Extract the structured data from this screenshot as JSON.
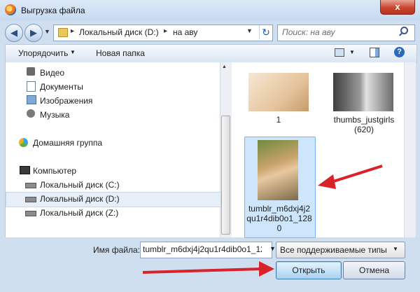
{
  "window": {
    "title": "Выгрузка файла",
    "close_label": "x"
  },
  "address": {
    "crumbs": [
      "Локальный диск (D:)",
      "на аву"
    ],
    "separator": "▸"
  },
  "search": {
    "placeholder": "Поиск: на аву"
  },
  "toolbar": {
    "organize_label": "Упорядочить",
    "new_folder_label": "Новая папка",
    "help_label": "?"
  },
  "nav": {
    "items": [
      {
        "label": "Видео",
        "icon": "video-library-icon"
      },
      {
        "label": "Документы",
        "icon": "documents-library-icon"
      },
      {
        "label": "Изображения",
        "icon": "pictures-library-icon"
      },
      {
        "label": "Музыка",
        "icon": "music-library-icon"
      },
      {
        "label": "Домашняя группа",
        "icon": "homegroup-icon"
      },
      {
        "label": "Компьютер",
        "icon": "computer-icon"
      },
      {
        "label": "Локальный диск (C:)",
        "icon": "disk-icon"
      },
      {
        "label": "Локальный диск (D:)",
        "icon": "disk-icon"
      },
      {
        "label": "Локальный диск (Z:)",
        "icon": "disk-icon"
      }
    ]
  },
  "files": [
    {
      "caption": "1"
    },
    {
      "caption": "thumbs_justgirls",
      "caption2": "(620)"
    },
    {
      "caption": "tumblr_m6dxj4j2",
      "caption2": "qu1r4dib0o1_128",
      "caption3": "0"
    }
  ],
  "footer": {
    "filename_label": "Имя файла:",
    "filename_value": "tumblr_m6dxj4j2qu1r4dib0o1_12",
    "type_value": "Все поддерживаемые типы",
    "open_label": "Открыть",
    "cancel_label": "Отмена"
  },
  "colors": {
    "accent": "#3c7fb1",
    "arrow": "#d8232a",
    "selection": "#cde6fb"
  }
}
